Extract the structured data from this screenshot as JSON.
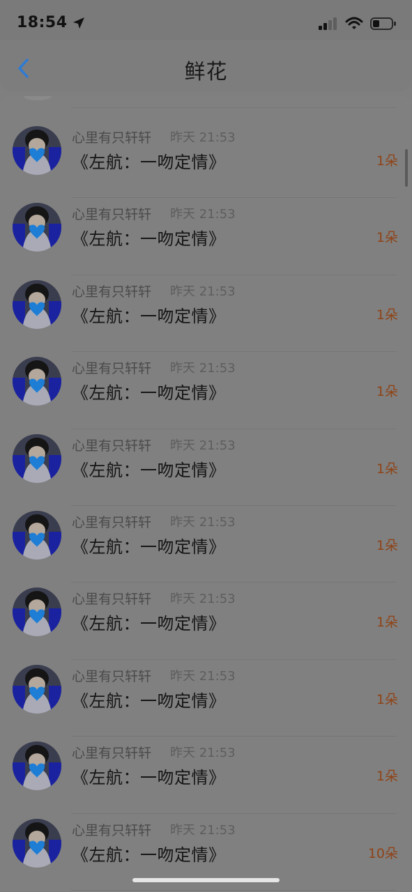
{
  "status_bar": {
    "time": "18:54",
    "icons": [
      "location-arrow-icon",
      "cellular-signal-icon",
      "wifi-icon",
      "battery-icon"
    ]
  },
  "nav": {
    "title": "鲜花",
    "back_icon": "chevron-left-icon"
  },
  "colors": {
    "accent": "#2c7bd6",
    "count": "#8f4316",
    "overlay": "#7f7f7f"
  },
  "items": [
    {
      "name": "心里有只轩轩",
      "time": "昨天 21:53",
      "title": "《左航：一吻定情》",
      "count": "1朵"
    },
    {
      "name": "心里有只轩轩",
      "time": "昨天 21:53",
      "title": "《左航：一吻定情》",
      "count": "1朵"
    },
    {
      "name": "心里有只轩轩",
      "time": "昨天 21:53",
      "title": "《左航：一吻定情》",
      "count": "1朵"
    },
    {
      "name": "心里有只轩轩",
      "time": "昨天 21:53",
      "title": "《左航：一吻定情》",
      "count": "1朵"
    },
    {
      "name": "心里有只轩轩",
      "time": "昨天 21:53",
      "title": "《左航：一吻定情》",
      "count": "1朵"
    },
    {
      "name": "心里有只轩轩",
      "time": "昨天 21:53",
      "title": "《左航：一吻定情》",
      "count": "1朵"
    },
    {
      "name": "心里有只轩轩",
      "time": "昨天 21:53",
      "title": "《左航：一吻定情》",
      "count": "1朵"
    },
    {
      "name": "心里有只轩轩",
      "time": "昨天 21:53",
      "title": "《左航：一吻定情》",
      "count": "1朵"
    },
    {
      "name": "心里有只轩轩",
      "time": "昨天 21:53",
      "title": "《左航：一吻定情》",
      "count": "1朵"
    },
    {
      "name": "心里有只轩轩",
      "time": "昨天 21:53",
      "title": "《左航：一吻定情》",
      "count": "10朵"
    }
  ]
}
